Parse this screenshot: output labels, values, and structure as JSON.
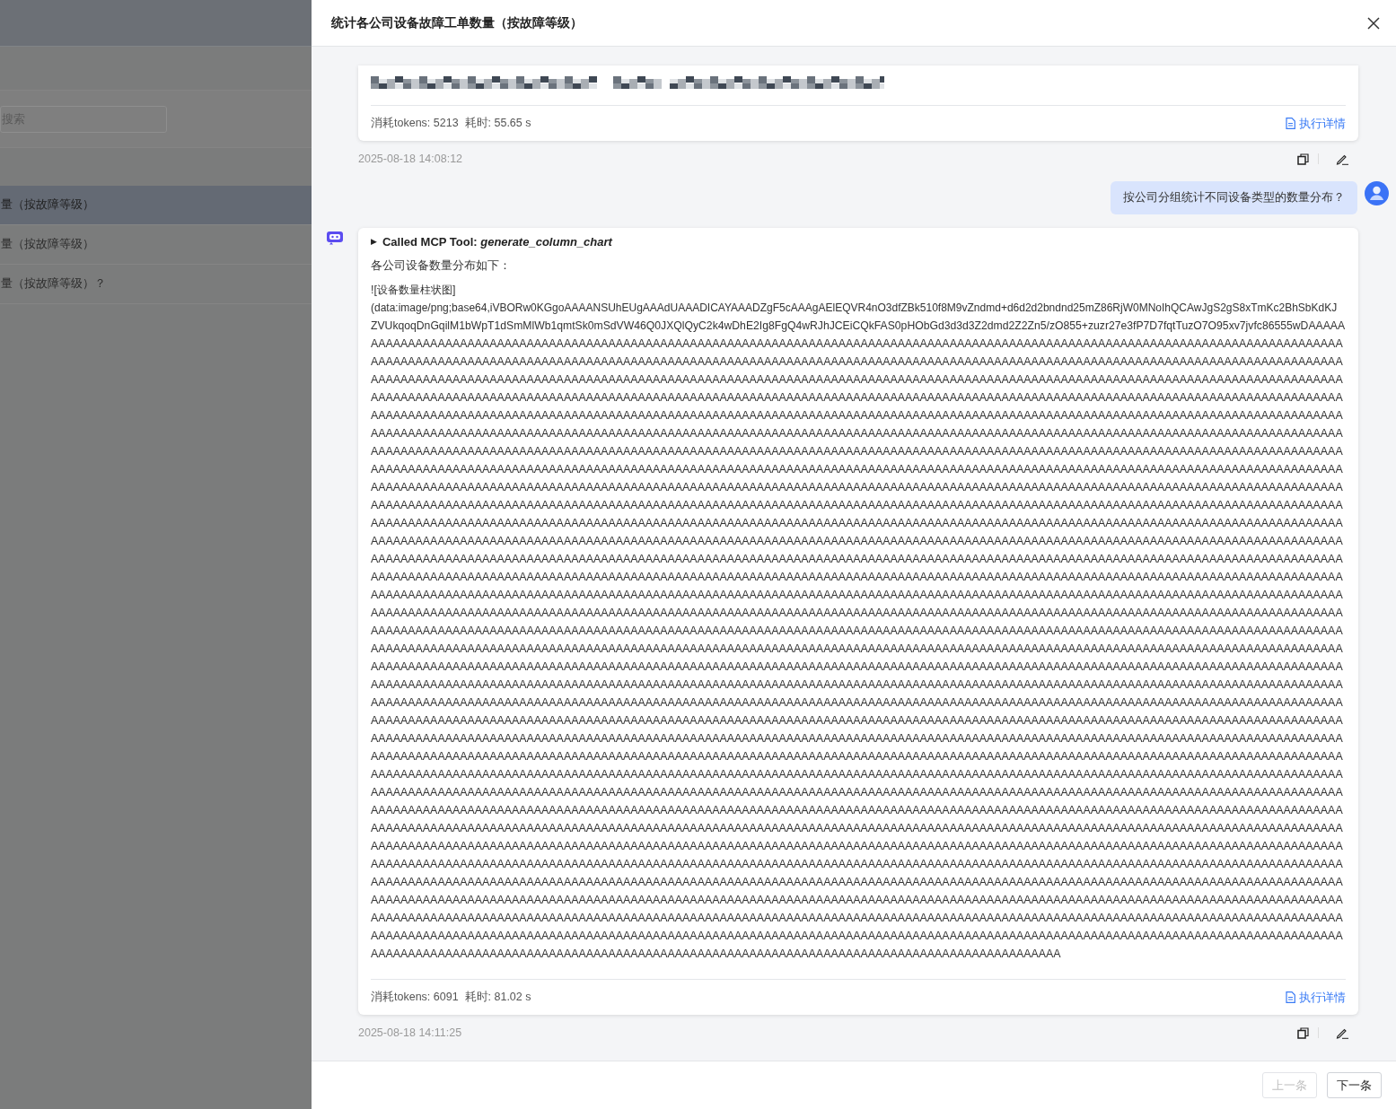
{
  "background_page": {
    "search": {
      "placeholder": "搜索"
    },
    "history": [
      {
        "text": "量（按故障等级）",
        "selected": true
      },
      {
        "text": "量（按故障等级）",
        "selected": false
      },
      {
        "text": "量（按故障等级）？",
        "selected": false
      }
    ]
  },
  "drawer": {
    "title": "统计各公司设备故障工单数量（按故障等级）",
    "messages": [
      {
        "kind": "assistant",
        "redacted": true,
        "tokens": "消耗tokens: 5213",
        "duration": "耗时: 55.65 s",
        "details_link": "执行详情",
        "timestamp": "2025-08-18 14:08:12"
      },
      {
        "kind": "user",
        "text": "按公司分组统计不同设备类型的数量分布？"
      },
      {
        "kind": "assistant",
        "tool_call": {
          "marker": "▶",
          "text": "Called MCP Tool: *generate_column_chart*"
        },
        "intro": "各公司设备数量分布如下：",
        "lines": [
          "![设备数量柱状图]",
          "(data:image/png;base64,iVBORw0KGgoAAAANSUhEUgAAAdUAAADICAYAAADZgF5cAAAgAElEQVR4nO3dfZBk510f8M9vZndmd+d6d2d2bndnd25mZ86RjW0MNoIhQCAwJgS2gS8xTmKc2BhSbKdKJ",
          "ZVUkqoqDnGqilM1bWpT1dSmMlWb1qmtSk0mSdVW46Q0JXQlQyC2k4wDhE2Ig8FgQ4wRJhJCEiCQkFAS0pHObGd3d3d3Z2dmd2Z2Zn5/zO855+zuzr27e3fP7D7fqtTuzO7O95xv7jvfc86555wDAAAAA",
          "AAAAAAAAAAAAAAAAAAAAAAAAAAAAAAAAAAAAAAAAAAAAAAAAAAAAAAAAAAAAAAAAAAAAAAAAAAAAAAAAAAAAAAAAAAAAAAAAAAAAAAAAAAAAAAAAAAAAAAAAAAAAAAAAAAA",
          "AAAAAAAAAAAAAAAAAAAAAAAAAAAAAAAAAAAAAAAAAAAAAAAAAAAAAAAAAAAAAAAAAAAAAAAAAAAAAAAAAAAAAAAAAAAAAAAAAAAAAAAAAAAAAAAAAAAAAAAAAAAAAAAAAAA",
          "AAAAAAAAAAAAAAAAAAAAAAAAAAAAAAAAAAAAAAAAAAAAAAAAAAAAAAAAAAAAAAAAAAAAAAAAAAAAAAAAAAAAAAAAAAAAAAAAAAAAAAAAAAAAAAAAAAAAAAAAAAAAAAAAAAA",
          "AAAAAAAAAAAAAAAAAAAAAAAAAAAAAAAAAAAAAAAAAAAAAAAAAAAAAAAAAAAAAAAAAAAAAAAAAAAAAAAAAAAAAAAAAAAAAAAAAAAAAAAAAAAAAAAAAAAAAAAAAAAAAAAAAAA",
          "AAAAAAAAAAAAAAAAAAAAAAAAAAAAAAAAAAAAAAAAAAAAAAAAAAAAAAAAAAAAAAAAAAAAAAAAAAAAAAAAAAAAAAAAAAAAAAAAAAAAAAAAAAAAAAAAAAAAAAAAAAAAAAAAAAA",
          "AAAAAAAAAAAAAAAAAAAAAAAAAAAAAAAAAAAAAAAAAAAAAAAAAAAAAAAAAAAAAAAAAAAAAAAAAAAAAAAAAAAAAAAAAAAAAAAAAAAAAAAAAAAAAAAAAAAAAAAAAAAAAAAAAAA",
          "AAAAAAAAAAAAAAAAAAAAAAAAAAAAAAAAAAAAAAAAAAAAAAAAAAAAAAAAAAAAAAAAAAAAAAAAAAAAAAAAAAAAAAAAAAAAAAAAAAAAAAAAAAAAAAAAAAAAAAAAAAAAAAAAAAA",
          "AAAAAAAAAAAAAAAAAAAAAAAAAAAAAAAAAAAAAAAAAAAAAAAAAAAAAAAAAAAAAAAAAAAAAAAAAAAAAAAAAAAAAAAAAAAAAAAAAAAAAAAAAAAAAAAAAAAAAAAAAAAAAAAAAAA",
          "AAAAAAAAAAAAAAAAAAAAAAAAAAAAAAAAAAAAAAAAAAAAAAAAAAAAAAAAAAAAAAAAAAAAAAAAAAAAAAAAAAAAAAAAAAAAAAAAAAAAAAAAAAAAAAAAAAAAAAAAAAAAAAAAAAA",
          "AAAAAAAAAAAAAAAAAAAAAAAAAAAAAAAAAAAAAAAAAAAAAAAAAAAAAAAAAAAAAAAAAAAAAAAAAAAAAAAAAAAAAAAAAAAAAAAAAAAAAAAAAAAAAAAAAAAAAAAAAAAAAAAAAAA",
          "AAAAAAAAAAAAAAAAAAAAAAAAAAAAAAAAAAAAAAAAAAAAAAAAAAAAAAAAAAAAAAAAAAAAAAAAAAAAAAAAAAAAAAAAAAAAAAAAAAAAAAAAAAAAAAAAAAAAAAAAAAAAAAAAAAA",
          "AAAAAAAAAAAAAAAAAAAAAAAAAAAAAAAAAAAAAAAAAAAAAAAAAAAAAAAAAAAAAAAAAAAAAAAAAAAAAAAAAAAAAAAAAAAAAAAAAAAAAAAAAAAAAAAAAAAAAAAAAAAAAAAAAAA",
          "AAAAAAAAAAAAAAAAAAAAAAAAAAAAAAAAAAAAAAAAAAAAAAAAAAAAAAAAAAAAAAAAAAAAAAAAAAAAAAAAAAAAAAAAAAAAAAAAAAAAAAAAAAAAAAAAAAAAAAAAAAAAAAAAAAA",
          "AAAAAAAAAAAAAAAAAAAAAAAAAAAAAAAAAAAAAAAAAAAAAAAAAAAAAAAAAAAAAAAAAAAAAAAAAAAAAAAAAAAAAAAAAAAAAAAAAAAAAAAAAAAAAAAAAAAAAAAAAAAAAAAAAAA",
          "AAAAAAAAAAAAAAAAAAAAAAAAAAAAAAAAAAAAAAAAAAAAAAAAAAAAAAAAAAAAAAAAAAAAAAAAAAAAAAAAAAAAAAAAAAAAAAAAAAAAAAAAAAAAAAAAAAAAAAAAAAAAAAAAAAA",
          "AAAAAAAAAAAAAAAAAAAAAAAAAAAAAAAAAAAAAAAAAAAAAAAAAAAAAAAAAAAAAAAAAAAAAAAAAAAAAAAAAAAAAAAAAAAAAAAAAAAAAAAAAAAAAAAAAAAAAAAAAAAAAAAAAAA",
          "AAAAAAAAAAAAAAAAAAAAAAAAAAAAAAAAAAAAAAAAAAAAAAAAAAAAAAAAAAAAAAAAAAAAAAAAAAAAAAAAAAAAAAAAAAAAAAAAAAAAAAAAAAAAAAAAAAAAAAAAAAAAAAAAAAA",
          "AAAAAAAAAAAAAAAAAAAAAAAAAAAAAAAAAAAAAAAAAAAAAAAAAAAAAAAAAAAAAAAAAAAAAAAAAAAAAAAAAAAAAAAAAAAAAAAAAAAAAAAAAAAAAAAAAAAAAAAAAAAAAAAAAAA",
          "AAAAAAAAAAAAAAAAAAAAAAAAAAAAAAAAAAAAAAAAAAAAAAAAAAAAAAAAAAAAAAAAAAAAAAAAAAAAAAAAAAAAAAAAAAAAAAAAAAAAAAAAAAAAAAAAAAAAAAAAAAAAAAAAAAA",
          "AAAAAAAAAAAAAAAAAAAAAAAAAAAAAAAAAAAAAAAAAAAAAAAAAAAAAAAAAAAAAAAAAAAAAAAAAAAAAAAAAAAAAAAAAAAAAAAAAAAAAAAAAAAAAAAAAAAAAAAAAAAAAAAAAAA",
          "AAAAAAAAAAAAAAAAAAAAAAAAAAAAAAAAAAAAAAAAAAAAAAAAAAAAAAAAAAAAAAAAAAAAAAAAAAAAAAAAAAAAAAAAAAAAAAAAAAAAAAAAAAAAAAAAAAAAAAAAAAAAAAAAAAA",
          "AAAAAAAAAAAAAAAAAAAAAAAAAAAAAAAAAAAAAAAAAAAAAAAAAAAAAAAAAAAAAAAAAAAAAAAAAAAAAAAAAAAAAAAAAAAAAAAAAAAAAAAAAAAAAAAAAAAAAAAAAAAAAAAAAAA",
          "AAAAAAAAAAAAAAAAAAAAAAAAAAAAAAAAAAAAAAAAAAAAAAAAAAAAAAAAAAAAAAAAAAAAAAAAAAAAAAAAAAAAAAAAAAAAAAAAAAAAAAAAAAAAAAAAAAAAAAAAAAAAAAAAAAA",
          "AAAAAAAAAAAAAAAAAAAAAAAAAAAAAAAAAAAAAAAAAAAAAAAAAAAAAAAAAAAAAAAAAAAAAAAAAAAAAAAAAAAAAAAAAAAAAAAAAAAAAAAAAAAAAAAAAAAAAAAAAAAAAAAAAAA",
          "AAAAAAAAAAAAAAAAAAAAAAAAAAAAAAAAAAAAAAAAAAAAAAAAAAAAAAAAAAAAAAAAAAAAAAAAAAAAAAAAAAAAAAAAAAAAAAAAAAAAAAAAAAAAAAAAAAAAAAAAAAAAAAAAAAA",
          "AAAAAAAAAAAAAAAAAAAAAAAAAAAAAAAAAAAAAAAAAAAAAAAAAAAAAAAAAAAAAAAAAAAAAAAAAAAAAAAAAAAAAAAAAAAAAAAAAAAAAAAAAAAAAAAAAAAAAAAAAAAAAAAAAAA",
          "AAAAAAAAAAAAAAAAAAAAAAAAAAAAAAAAAAAAAAAAAAAAAAAAAAAAAAAAAAAAAAAAAAAAAAAAAAAAAAAAAAAAAAAAAAAAAAAAAAAAAAAAAAAAAAAAAAAAAAAAAAAAAAAAAAA",
          "AAAAAAAAAAAAAAAAAAAAAAAAAAAAAAAAAAAAAAAAAAAAAAAAAAAAAAAAAAAAAAAAAAAAAAAAAAAAAAAAAAAAAAAAAAAAAAAAAAAAAAAAAAAAAAAAAAAAAAAAAAAAAAAAAAA",
          "AAAAAAAAAAAAAAAAAAAAAAAAAAAAAAAAAAAAAAAAAAAAAAAAAAAAAAAAAAAAAAAAAAAAAAAAAAAAAAAAAAAAAAAAAAAAAAAAAAAAAAAAAAAAAAAAAAAAAAAAAAAAAAAAAAA",
          "AAAAAAAAAAAAAAAAAAAAAAAAAAAAAAAAAAAAAAAAAAAAAAAAAAAAAAAAAAAAAAAAAAAAAAAAAAAAAAAAAAAAAAAAAAAAAAAAAAAAAAAAAAAAAAAAAAAAAAAAAAAAAAAAAAA",
          "AAAAAAAAAAAAAAAAAAAAAAAAAAAAAAAAAAAAAAAAAAAAAAAAAAAAAAAAAAAAAAAAAAAAAAAAAAAAAAAAAAAAAAAAAAAAAAAAAAAAAAAAAAAAAAAAAAAAAAAAAAAAAAAAAAA",
          "AAAAAAAAAAAAAAAAAAAAAAAAAAAAAAAAAAAAAAAAAAAAAAAAAAAAAAAAAAAAAAAAAAAAAAAAAAAAAAAAAAAAAAAAAAAAAAAAAAAAAAAAAAAAAAAAAAAAAAAAAAAAAAAAAAA",
          "AAAAAAAAAAAAAAAAAAAAAAAAAAAAAAAAAAAAAAAAAAAAAAAAAAAAAAAAAAAAAAAAAAAAAAAAAAAAAAAAAAAAAAAAAAAAAAAAAAAAAAAAAAAAAAAAAAAAAAAAAAAAAAAAAAA",
          "AAAAAAAAAAAAAAAAAAAAAAAAAAAAAAAAAAAAAAAAAAAAAAAAAAAAAAAAAAAAAAAAAAAAAAAAAAAAAAAAAAAAAAAAAAAAAAAAAAAAAAAAAAAAAAAAAAAAAAAAAAAAAAAAAAA",
          "AAAAAAAAAAAAAAAAAAAAAAAAAAAAAAAAAAAAAAAAAAAAAAAAAAAAAAAAAAAAAAAAAAAAAAAAAAAAAAAAAAAAAAAAAAAAA"
        ],
        "tokens": "消耗tokens: 6091",
        "duration": "耗时: 81.02 s",
        "details_link": "执行详情",
        "timestamp": "2025-08-18 14:11:25"
      }
    ],
    "footer": {
      "buttons": [
        {
          "label": "上一条",
          "disabled": true
        },
        {
          "label": "下一条",
          "disabled": false
        }
      ]
    }
  }
}
